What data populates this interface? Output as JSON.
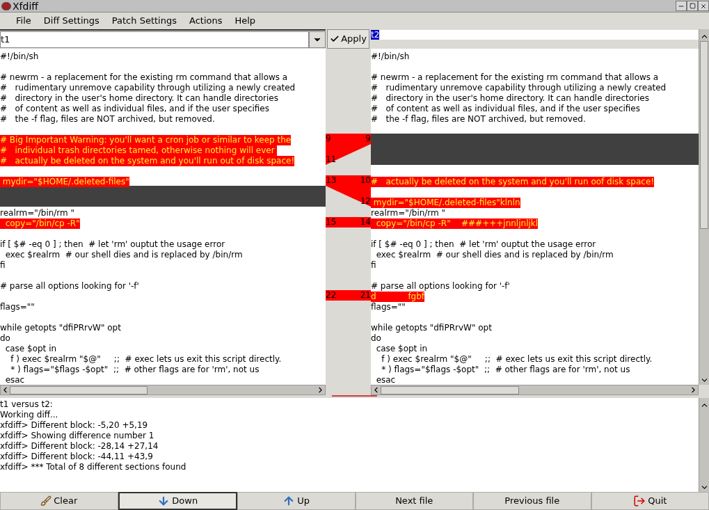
{
  "window": {
    "title": "Xfdiff"
  },
  "menu": [
    "File",
    "Diff Settings",
    "Patch Settings",
    "Actions",
    "Help"
  ],
  "left_file": {
    "value": "t1"
  },
  "apply_button": "Apply",
  "right_file": {
    "value": "t2"
  },
  "left_lines": [
    {
      "kind": "normal",
      "text": "#!/bin/sh"
    },
    {
      "kind": "blank"
    },
    {
      "kind": "normal",
      "text": "# newrm - a replacement for the existing rm command that allows a"
    },
    {
      "kind": "normal",
      "text": "#   rudimentary unremove capability through utilizing a newly created"
    },
    {
      "kind": "normal",
      "text": "#   directory in the user's home directory. It can handle directories"
    },
    {
      "kind": "normal",
      "text": "#   of content as well as individual files, and if the user specifies"
    },
    {
      "kind": "normal",
      "text": "#   the -f flag, files are NOT archived, but removed."
    },
    {
      "kind": "blank"
    },
    {
      "kind": "changed",
      "text": "# Big Important Warning: you'll want a cron job or similar to keep the",
      "gutter_number": "9",
      "diff": true
    },
    {
      "kind": "changed",
      "text": "#   individual trash directories tamed, otherwise nothing will ever ",
      "diff": true
    },
    {
      "kind": "changed",
      "text": "#   actually be deleted on the system and you'll run out of disk space!",
      "gutter_number": "11",
      "diff": true
    },
    {
      "kind": "blank"
    },
    {
      "kind": "changed",
      "text": " mydir=\"$HOME/.deleted-files\"",
      "gutter_number": "13",
      "diff": true
    },
    {
      "kind": "filler"
    },
    {
      "kind": "filler"
    },
    {
      "kind": "normal",
      "text": "realrm=\"/bin/rm \""
    },
    {
      "kind": "changed",
      "text": "  copy=\"/bin/cp -R\"",
      "gutter_number": "15",
      "diff": true
    },
    {
      "kind": "blank"
    },
    {
      "kind": "normal",
      "text": "if [ $# -eq 0 ] ; then  # let 'rm' ouptut the usage error"
    },
    {
      "kind": "normal",
      "text": "  exec $realrm  # our shell dies and is replaced by /bin/rm"
    },
    {
      "kind": "normal",
      "text": "fi"
    },
    {
      "kind": "blank"
    },
    {
      "kind": "normal",
      "text": "# parse all options looking for '-f'"
    },
    {
      "kind": "blank",
      "gutter_number": "22",
      "diff": true
    },
    {
      "kind": "normal",
      "text": "flags=\"\""
    },
    {
      "kind": "blank"
    },
    {
      "kind": "normal",
      "text": "while getopts \"dfiPRrvW\" opt"
    },
    {
      "kind": "normal",
      "text": "do"
    },
    {
      "kind": "normal",
      "text": "  case $opt in"
    },
    {
      "kind": "normal",
      "text": "    f ) exec $realrm \"$@\"     ;;  # exec lets us exit this script directly."
    },
    {
      "kind": "normal",
      "text": "    * ) flags=\"$flags -$opt\"  ;;  # other flags are for 'rm', not us"
    },
    {
      "kind": "normal",
      "text": "  esac"
    }
  ],
  "right_lines": [
    {
      "kind": "normal",
      "text": "#!/bin/sh"
    },
    {
      "kind": "blank"
    },
    {
      "kind": "normal",
      "text": "# newrm - a replacement for the existing rm command that allows a"
    },
    {
      "kind": "normal",
      "text": "#   rudimentary unremove capability through utilizing a newly created"
    },
    {
      "kind": "normal",
      "text": "#   directory in the user's home directory. It can handle directories"
    },
    {
      "kind": "normal",
      "text": "#   of content as well as individual files, and if the user specifies"
    },
    {
      "kind": "normal",
      "text": "#   the -f flag, files are NOT archived, but removed."
    },
    {
      "kind": "blank"
    },
    {
      "kind": "filler",
      "gutter_number": "9",
      "diff": true
    },
    {
      "kind": "filler"
    },
    {
      "kind": "filler"
    },
    {
      "kind": "blank"
    },
    {
      "kind": "changed",
      "text": "#   actually be deleted on the system and you'll run oof disk space!",
      "gutter_number": "10",
      "diff": true
    },
    {
      "kind": "blank",
      "diff": true
    },
    {
      "kind": "changed",
      "text": " mydir=\"$HOME/.deleted-files\"klnln",
      "gutter_number": "12",
      "diff": true
    },
    {
      "kind": "normal",
      "text": "realrm=\"/bin/rm \""
    },
    {
      "kind": "changed",
      "text": "  copy=\"/bin/cp -R\"    ###+++jnnljnljkl",
      "gutter_number": "14",
      "diff": true
    },
    {
      "kind": "blank"
    },
    {
      "kind": "normal",
      "text": "if [ $# -eq 0 ] ; then  # let 'rm' ouptut the usage error"
    },
    {
      "kind": "normal",
      "text": "  exec $realrm  # our shell dies and is replaced by /bin/rm"
    },
    {
      "kind": "normal",
      "text": "fi"
    },
    {
      "kind": "blank"
    },
    {
      "kind": "normal",
      "text": "# parse all options looking for '-f'"
    },
    {
      "kind": "changed",
      "text": "d            fgbf",
      "gutter_number": "21",
      "diff": true
    },
    {
      "kind": "normal",
      "text": "flags=\"\""
    },
    {
      "kind": "blank"
    },
    {
      "kind": "normal",
      "text": "while getopts \"dfiPRrvW\" opt"
    },
    {
      "kind": "normal",
      "text": "do"
    },
    {
      "kind": "normal",
      "text": "  case $opt in"
    },
    {
      "kind": "normal",
      "text": "    f ) exec $realrm \"$@\"     ;;  # exec lets us exit this script directly."
    },
    {
      "kind": "normal",
      "text": "    * ) flags=\"$flags -$opt\"  ;;  # other flags are for 'rm', not us"
    },
    {
      "kind": "normal",
      "text": "  esac"
    }
  ],
  "log": [
    "t1 versus t2:",
    "Working diff...",
    "xfdiff> Different block: -5,20 +5,19",
    "xfdiff> Showing difference number 1",
    "xfdiff> Different block: -28,14 +27,14",
    "xfdiff> Different block: -44,11 +43,9",
    "xfdiff> *** Total of 8 different sections found"
  ],
  "buttons": [
    {
      "kind": "clear",
      "label": "Clear",
      "selected": false
    },
    {
      "kind": "down",
      "label": "Down",
      "selected": true
    },
    {
      "kind": "up",
      "label": "Up",
      "selected": false
    },
    {
      "kind": "plain",
      "label": "Next file",
      "selected": false
    },
    {
      "kind": "plain",
      "label": "Previous file",
      "selected": false
    },
    {
      "kind": "quit",
      "label": "Quit",
      "selected": false
    }
  ]
}
